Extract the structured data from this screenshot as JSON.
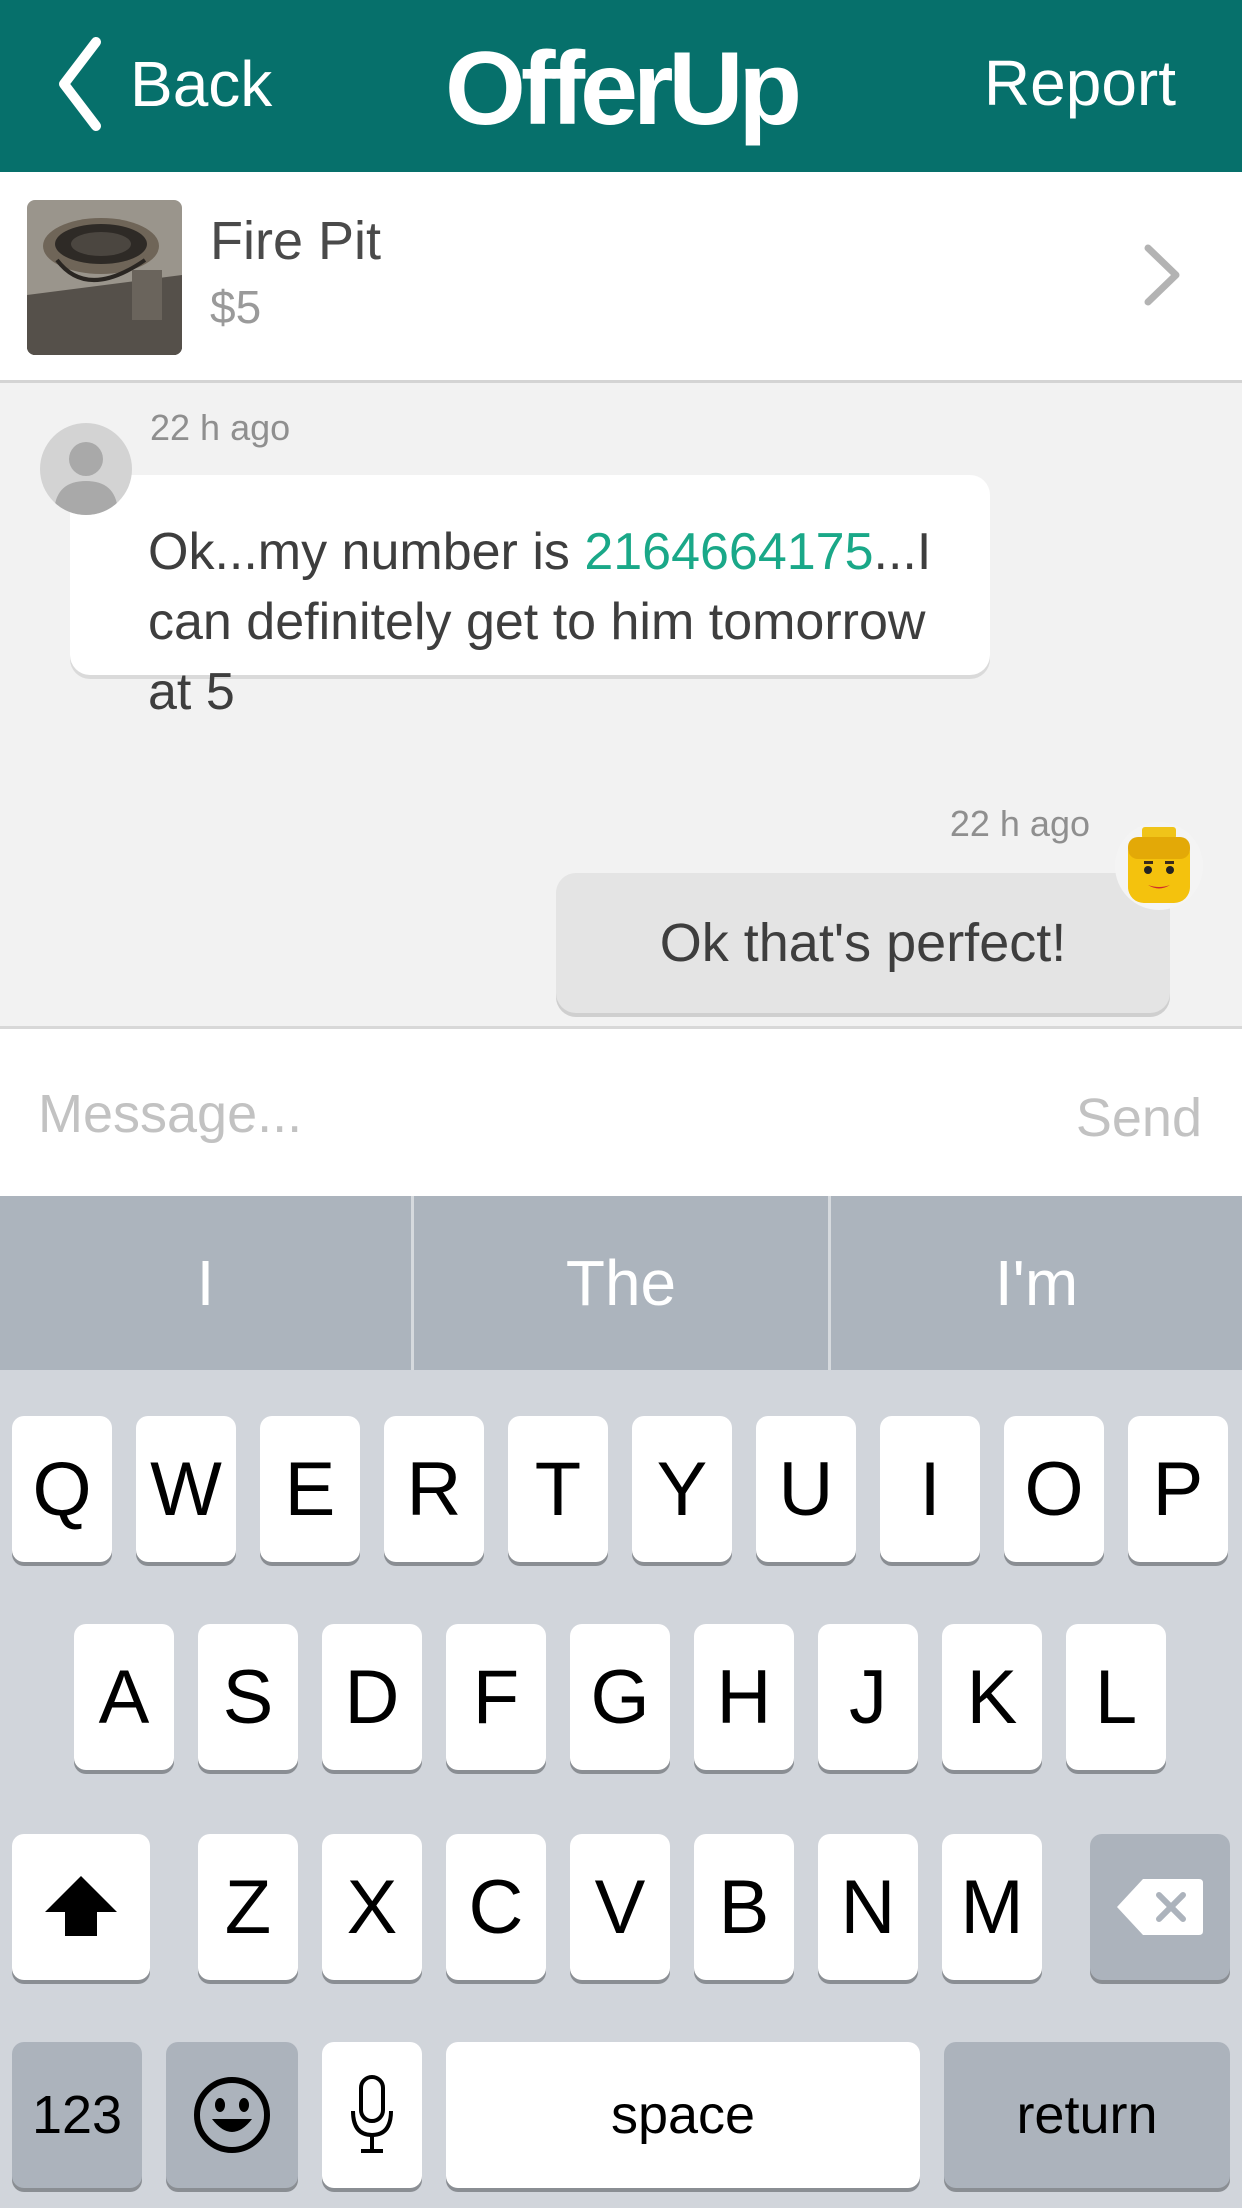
{
  "header": {
    "back_label": "Back",
    "brand": "OfferUp",
    "report_label": "Report",
    "bg_color": "#06706b"
  },
  "item": {
    "title": "Fire Pit",
    "price": "$5"
  },
  "chat": {
    "messages": [
      {
        "timestamp": "22 h ago",
        "text_before": "Ok...my number is ",
        "phone": "2164664175",
        "text_after": "...I can definitely get to him tomorrow at 5",
        "side": "left"
      },
      {
        "timestamp": "22 h ago",
        "text": "Ok that's perfect!",
        "side": "right"
      }
    ]
  },
  "composer": {
    "placeholder": "Message...",
    "send_label": "Send"
  },
  "keyboard": {
    "suggestions": [
      "I",
      "The",
      "I'm"
    ],
    "row1": [
      "Q",
      "W",
      "E",
      "R",
      "T",
      "Y",
      "U",
      "I",
      "O",
      "P"
    ],
    "row2": [
      "A",
      "S",
      "D",
      "F",
      "G",
      "H",
      "J",
      "K",
      "L"
    ],
    "row3": [
      "Z",
      "X",
      "C",
      "V",
      "B",
      "N",
      "M"
    ],
    "numbers_label": "123",
    "space_label": "space",
    "return_label": "return",
    "shift_icon": "shift-arrow-icon",
    "delete_icon": "backspace-icon",
    "emoji_icon": "emoji-icon",
    "mic_icon": "microphone-icon"
  }
}
